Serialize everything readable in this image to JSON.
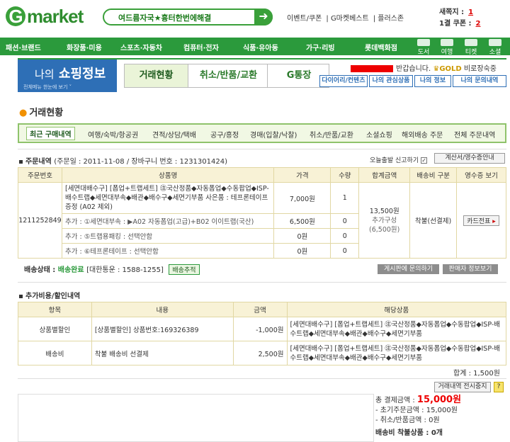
{
  "header": {
    "logo": "market",
    "logo_g": "G",
    "banner_text": "여드름자국★흉터한번에해결",
    "toplinks": [
      "이벤트/쿠폰",
      "G마켓베스트",
      "플러스존"
    ],
    "new_notes_label": "새쪽지 :",
    "new_notes_value": "1",
    "coupons_label": "1결 쿠폰 :",
    "coupons_value": "2"
  },
  "catnav": {
    "items": [
      "패션·브랜드",
      "화장품·미용",
      "스포츠·자동차",
      "컴퓨터·전자",
      "식품·유아동",
      "가구·리빙",
      "롯데백화점"
    ],
    "icons": [
      "도서",
      "여행",
      "티켓",
      "소셜"
    ]
  },
  "myshop": {
    "title_small": "나의",
    "title_big": "쇼핑정보",
    "sub": "전체메뉴 한눈에 보기 ˅",
    "tabs": [
      "거래현황",
      "취소/반품/교환",
      "G통장"
    ],
    "greet": "반갑습니다.",
    "grade": "GOLD",
    "grade_extra": "비로장숙중",
    "subtabs": [
      "다이어리/컨텐츠",
      "나의 관심상품",
      "나의 정보",
      "나의 문의내역"
    ]
  },
  "section_title": "거래현황",
  "filter": {
    "items": [
      "최근 구매내역",
      "여행/숙박/항공권",
      "견적/상담/택배",
      "공구/흥정",
      "경매(입찰/낙찰)",
      "취소/반품/교환",
      "소셜쇼핑",
      "해외배송 주문",
      "전체 주문내역"
    ]
  },
  "order": {
    "title": "주문내역",
    "meta": "(주문일 : 2011-11-08 / 장바구니 번호 : 1231301424)",
    "report_label": "오늘출발 신고하기",
    "receipt_btn": "계산서/영수증안내",
    "headers": [
      "주문번호",
      "상품명",
      "가격",
      "수량",
      "합계금액",
      "배송비 구분",
      "영수증 보기"
    ],
    "order_no": "1211252849",
    "product": "[세면대배수구] [폽업+트랩세트] ㊟국산정품◆자동폽업◆수동팝업◆ISP-배수트랩◆세면대부속◆배관◆배수구◆세면기부품 사은품 : 테프론테이프증정 (A02 제외)",
    "price": "7,000원",
    "qty": "1",
    "sum_main": "13,500원",
    "sum_sub_label": "추가구성",
    "sum_sub": "(6,500원)",
    "ship_type": "착불(선결제)",
    "card_btn": "카드전표",
    "extras": [
      {
        "label": "추가 : ①세면대부속 : ▶A02 자동폽업(고급)+B02 이이트랩(국산)",
        "price": "6,500원",
        "qty": "0"
      },
      {
        "label": "추가 : ⑤트랩용패킹 : 선택안함",
        "price": "0원",
        "qty": "0"
      },
      {
        "label": "추가 : ⑥테프론테이프 : 선택안함",
        "price": "0원",
        "qty": "0"
      }
    ],
    "ship_status_label": "배송상태 :",
    "ship_status": "배송완료",
    "courier": "[대한통운 : 1588-1255]",
    "track_btn": "배송추적",
    "ask_btn": "게시판에 문의하기",
    "seller_btn": "판매자 정보보기"
  },
  "additional": {
    "title": "추가비용/할인내역",
    "headers": [
      "항목",
      "내용",
      "금액",
      "해당상품"
    ],
    "rows": [
      {
        "item": "상품별할인",
        "content": "[상품별할인] 상품번호:169326389",
        "amount": "-1,000원",
        "product": "[세면대배수구] [폽업+트랩세트] ㊟국산정품◆자동폽업◆수동팝업◆ISP-배수트랩◆세면대부속◆배관◆배수구◆세면기부품"
      },
      {
        "item": "배송비",
        "content": "착불 배송비 선결제",
        "amount": "2,500원",
        "product": "[세면대배수구] [폽업+트랩세트] ㊟국산정품◆자동폽업◆수동팝업◆ISP-배수트랩◆세면대부속◆배관◆배수구◆세면기부품"
      }
    ],
    "total": "합계 : 1,500원"
  },
  "summary": {
    "hide_btn": "거래내역 전시중지",
    "help": "?",
    "total_label": "총 결제금액 :",
    "total": "15,000원",
    "initial": "- 초기주문금액 : 15,000원",
    "cancel": "- 취소/반품금액 : 0원",
    "cod": "배송비 착불상품 : 0개"
  }
}
